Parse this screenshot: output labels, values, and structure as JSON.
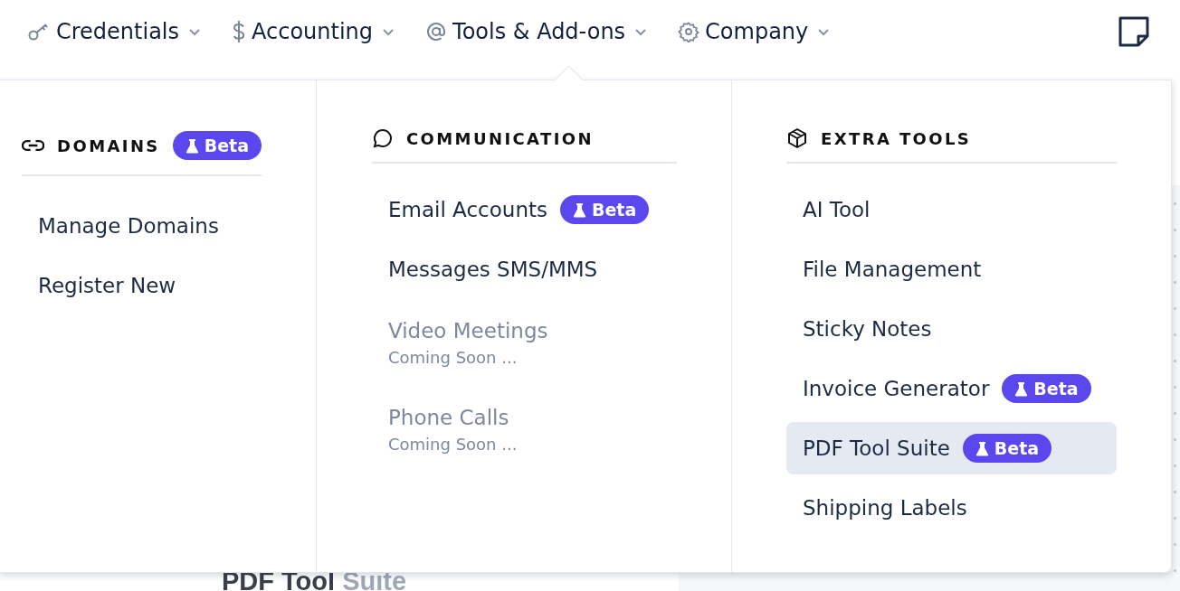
{
  "nav": [
    {
      "label": "Credentials"
    },
    {
      "label": "Accounting"
    },
    {
      "label": "Tools & Add-ons"
    },
    {
      "label": "Company"
    }
  ],
  "page_heading": "**PDF Tool** Suite",
  "menu": {
    "columns": [
      {
        "title": "DOMAINS",
        "badge": "Beta",
        "items": [
          {
            "label": "Manage Domains",
            "disabled": false,
            "selected": false
          },
          {
            "label": "Register New",
            "disabled": false,
            "selected": false
          }
        ]
      },
      {
        "title": "COMMUNICATION",
        "items": [
          {
            "label": "Email Accounts",
            "badge": "Beta",
            "disabled": false,
            "selected": false
          },
          {
            "label": "Messages SMS/MMS",
            "disabled": false,
            "selected": false
          },
          {
            "label": "Video Meetings",
            "subtitle": "Coming Soon ...",
            "disabled": true,
            "selected": false
          },
          {
            "label": "Phone Calls",
            "subtitle": "Coming Soon ...",
            "disabled": true,
            "selected": false
          }
        ]
      },
      {
        "title": "EXTRA TOOLS",
        "items": [
          {
            "label": "AI Tool",
            "disabled": false,
            "selected": false
          },
          {
            "label": "File Management",
            "disabled": false,
            "selected": false
          },
          {
            "label": "Sticky Notes",
            "disabled": false,
            "selected": false
          },
          {
            "label": "Invoice Generator",
            "badge": "Beta",
            "disabled": false,
            "selected": false
          },
          {
            "label": "PDF Tool Suite",
            "badge": "Beta",
            "disabled": false,
            "selected": true
          },
          {
            "label": "Shipping Labels",
            "disabled": false,
            "selected": false
          }
        ]
      }
    ]
  }
}
